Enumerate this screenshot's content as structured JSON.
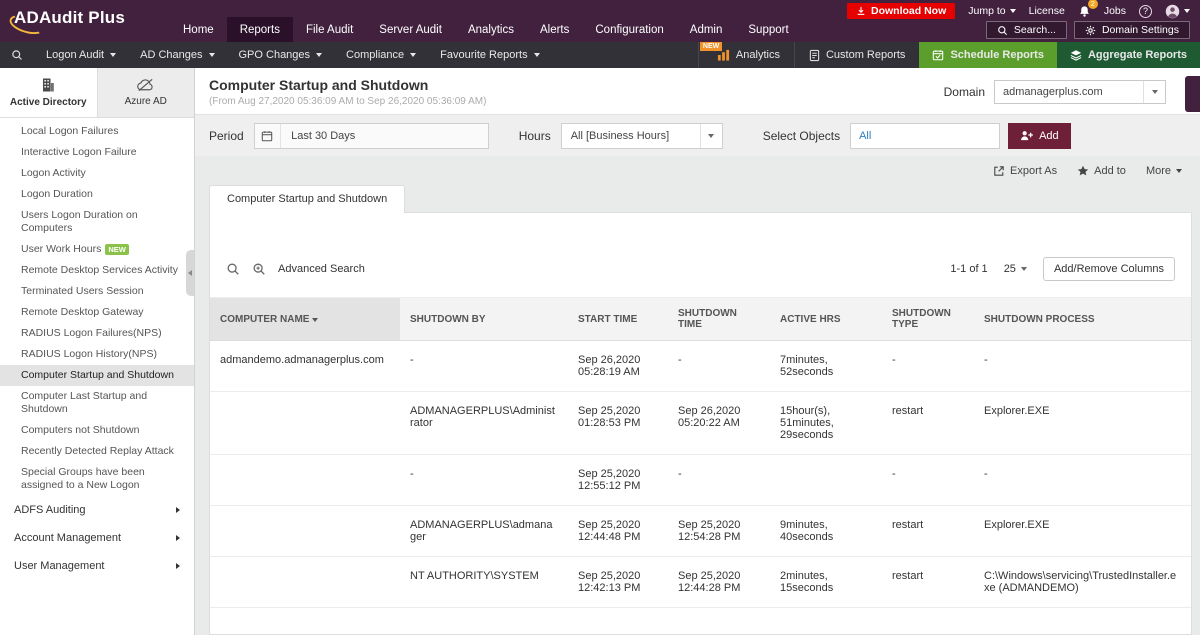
{
  "colors": {
    "brand_bar": "#41213e",
    "brand_bar_active": "#2a1129",
    "menu_bar": "#323137",
    "download_red": "#e60000",
    "schedule_green": "#5c9e2c",
    "aggregate_green": "#1e5b33",
    "add_maroon": "#6d2038",
    "badge_green": "#8bc34a",
    "analytics_orange": "#f0932b",
    "link_blue": "#2f7ec1"
  },
  "topbar": {
    "logo": "ADAudit Plus",
    "nav": [
      {
        "label": "Home"
      },
      {
        "label": "Reports"
      },
      {
        "label": "File Audit"
      },
      {
        "label": "Server Audit"
      },
      {
        "label": "Analytics"
      },
      {
        "label": "Alerts"
      },
      {
        "label": "Configuration"
      },
      {
        "label": "Admin"
      },
      {
        "label": "Support"
      }
    ],
    "download_now": "Download Now",
    "jump_to": "Jump to",
    "license": "License",
    "notifications_badge": "2",
    "jobs": "Jobs",
    "help": "?",
    "search": "Search...",
    "domain_settings": "Domain Settings"
  },
  "menubar": {
    "items": [
      "Logon Audit",
      "AD Changes",
      "GPO Changes",
      "Compliance",
      "Favourite Reports"
    ],
    "analytics": "Analytics",
    "analytics_badge": "NEW",
    "custom_reports": "Custom Reports",
    "schedule_reports": "Schedule Reports",
    "aggregate_reports": "Aggregate Reports"
  },
  "sidebar": {
    "tabs": [
      {
        "label": "Active Directory"
      },
      {
        "label": "Azure AD"
      }
    ],
    "items": [
      {
        "label": "Local Logon Failures"
      },
      {
        "label": "Interactive Logon Failure"
      },
      {
        "label": "Logon Activity"
      },
      {
        "label": "Logon Duration"
      },
      {
        "label": "Users Logon Duration on Computers"
      },
      {
        "label": "User Work Hours",
        "badge": "NEW"
      },
      {
        "label": "Remote Desktop Services Activity"
      },
      {
        "label": "Terminated Users Session"
      },
      {
        "label": "Remote Desktop Gateway"
      },
      {
        "label": "RADIUS Logon Failures(NPS)"
      },
      {
        "label": "RADIUS Logon History(NPS)"
      },
      {
        "label": "Computer Startup and Shutdown"
      },
      {
        "label": "Computer Last Startup and Shutdown"
      },
      {
        "label": "Computers not Shutdown"
      },
      {
        "label": "Recently Detected Replay Attack"
      },
      {
        "label": "Special Groups have been assigned to a New Logon"
      }
    ],
    "groups": [
      "ADFS Auditing",
      "Account Management",
      "User Management"
    ]
  },
  "report": {
    "title": "Computer Startup and Shutdown",
    "subtitle": "(From Aug 27,2020 05:36:09 AM to Sep 26,2020 05:36:09 AM)",
    "domain_label": "Domain",
    "domain_value": "admanagerplus.com",
    "period_label": "Period",
    "period_value": "Last 30 Days",
    "hours_label": "Hours",
    "hours_value": "All [Business Hours]",
    "select_objects_label": "Select Objects",
    "select_objects_value": "All",
    "add_button": "Add",
    "export_as": "Export As",
    "add_to": "Add to",
    "more": "More",
    "tab": "Computer Startup and Shutdown"
  },
  "table": {
    "advanced_search": "Advanced Search",
    "pagination": "1-1 of 1",
    "page_size": "25",
    "add_remove_columns": "Add/Remove Columns",
    "headers": [
      "COMPUTER NAME",
      "SHUTDOWN BY",
      "START TIME",
      "SHUTDOWN TIME",
      "ACTIVE HRS",
      "SHUTDOWN TYPE",
      "SHUTDOWN PROCESS"
    ],
    "rows": [
      [
        "admandemo.admanagerplus.com",
        "-",
        "Sep 26,2020 05:28:19 AM",
        "-",
        "7minutes, 52seconds",
        "-",
        "-"
      ],
      [
        "",
        "ADMANAGERPLUS\\Administrator",
        "Sep 25,2020 01:28:53 PM",
        "Sep 26,2020 05:20:22 AM",
        "15hour(s), 51minutes, 29seconds",
        "restart",
        "Explorer.EXE"
      ],
      [
        "",
        "-",
        "Sep 25,2020 12:55:12 PM",
        "-",
        "",
        "-",
        "-"
      ],
      [
        "",
        "ADMANAGERPLUS\\admanager",
        "Sep 25,2020 12:44:48 PM",
        "Sep 25,2020 12:54:28 PM",
        "9minutes, 40seconds",
        "restart",
        "Explorer.EXE"
      ],
      [
        "",
        "NT AUTHORITY\\SYSTEM",
        "Sep 25,2020 12:42:13 PM",
        "Sep 25,2020 12:44:28 PM",
        "2minutes, 15seconds",
        "restart",
        "C:\\Windows\\servicing\\TrustedInstaller.exe (ADMANDEMO)"
      ]
    ]
  }
}
